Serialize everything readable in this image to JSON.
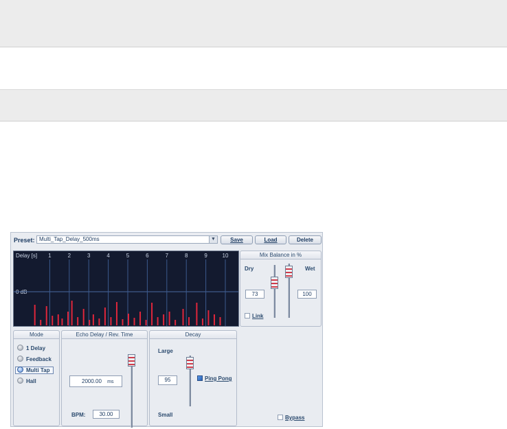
{
  "preset": {
    "label": "Preset:",
    "value": "Multi_Tap_Delay_500ms",
    "save_label": "Save",
    "load_label": "Load",
    "delete_label": "Delete"
  },
  "graph": {
    "axis_label": "Delay [s]",
    "db_label": "0 dB",
    "ticks": [
      "1",
      "2",
      "3",
      "4",
      "5",
      "6",
      "7",
      "8",
      "9",
      "10"
    ],
    "tap_color": "#e0263b"
  },
  "chart_data": {
    "type": "bar",
    "xlabel": "Delay [s]",
    "xlim": [
      0,
      10
    ],
    "taps": [
      {
        "t": 0.2,
        "h": 0.3
      },
      {
        "t": 0.5,
        "h": 0.08
      },
      {
        "t": 0.8,
        "h": 0.28
      },
      {
        "t": 1.1,
        "h": 0.14
      },
      {
        "t": 1.4,
        "h": 0.16
      },
      {
        "t": 1.6,
        "h": 0.1
      },
      {
        "t": 1.9,
        "h": 0.2
      },
      {
        "t": 2.1,
        "h": 0.36
      },
      {
        "t": 2.4,
        "h": 0.12
      },
      {
        "t": 2.7,
        "h": 0.24
      },
      {
        "t": 3.0,
        "h": 0.08
      },
      {
        "t": 3.2,
        "h": 0.16
      },
      {
        "t": 3.5,
        "h": 0.1
      },
      {
        "t": 3.8,
        "h": 0.26
      },
      {
        "t": 4.1,
        "h": 0.12
      },
      {
        "t": 4.4,
        "h": 0.34
      },
      {
        "t": 4.7,
        "h": 0.09
      },
      {
        "t": 5.0,
        "h": 0.17
      },
      {
        "t": 5.3,
        "h": 0.11
      },
      {
        "t": 5.6,
        "h": 0.2
      },
      {
        "t": 5.9,
        "h": 0.08
      },
      {
        "t": 6.2,
        "h": 0.33
      },
      {
        "t": 6.5,
        "h": 0.12
      },
      {
        "t": 6.8,
        "h": 0.16
      },
      {
        "t": 7.1,
        "h": 0.2
      },
      {
        "t": 7.4,
        "h": 0.08
      },
      {
        "t": 7.8,
        "h": 0.24
      },
      {
        "t": 8.1,
        "h": 0.12
      },
      {
        "t": 8.5,
        "h": 0.33
      },
      {
        "t": 8.8,
        "h": 0.1
      },
      {
        "t": 9.1,
        "h": 0.22
      },
      {
        "t": 9.4,
        "h": 0.16
      },
      {
        "t": 9.7,
        "h": 0.12
      }
    ]
  },
  "mix": {
    "title": "Mix Balance in %",
    "dry_label": "Dry",
    "wet_label": "Wet",
    "dry_value": "73",
    "wet_value": "100",
    "link_label": "Link"
  },
  "mode": {
    "title": "Mode",
    "options": [
      "1 Delay",
      "Feedback",
      "Multi Tap",
      "Hall"
    ],
    "selected": "Multi Tap"
  },
  "echo": {
    "title": "Echo Delay / Rev. Time",
    "time_value": "2000.00",
    "time_unit": "ms",
    "bpm_label": "BPM:",
    "bpm_value": "30.00"
  },
  "decay": {
    "title": "Decay",
    "large_label": "Large",
    "small_label": "Small",
    "value": "95",
    "ping_pong_label": "Ping Pong"
  },
  "bypass": {
    "label": "Bypass"
  }
}
